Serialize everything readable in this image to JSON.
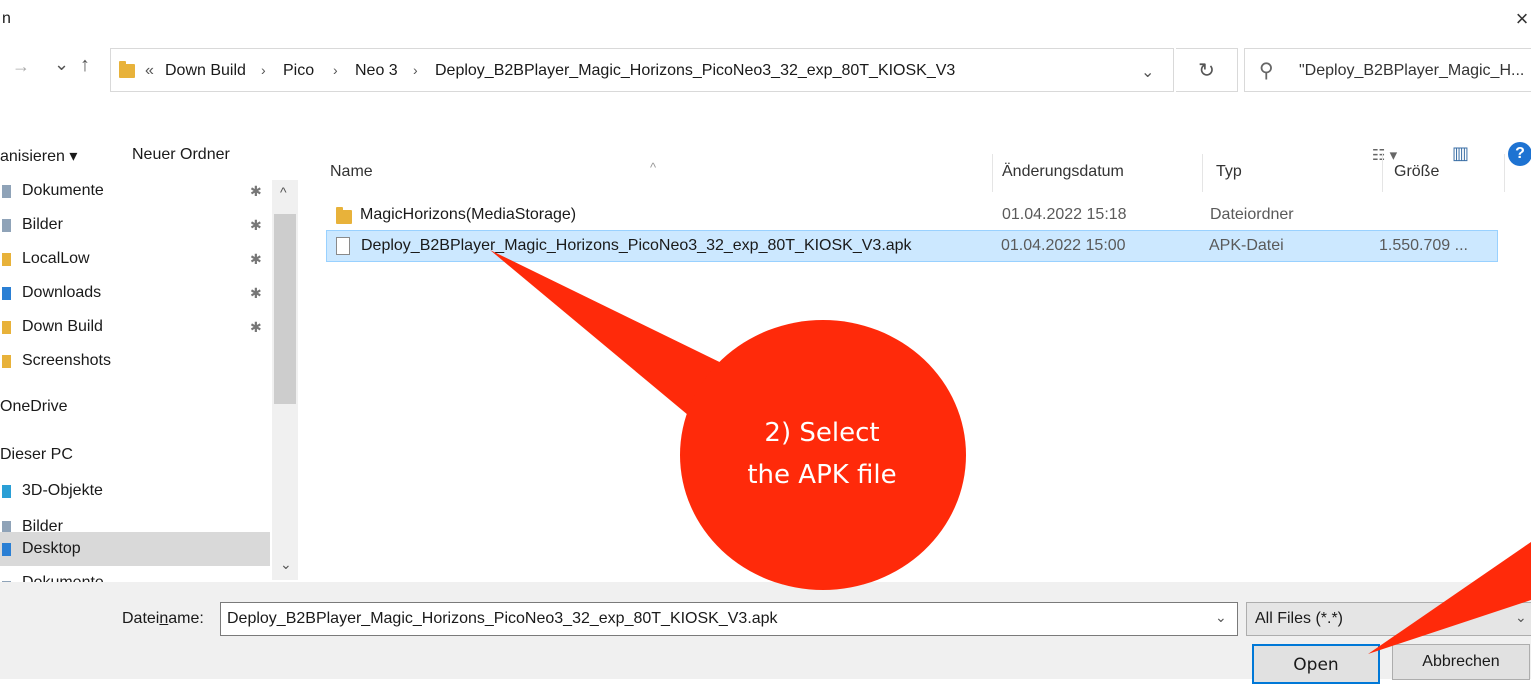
{
  "window": {
    "title": "n",
    "close_glyph": "×"
  },
  "nav": {
    "back_glyph": "→",
    "history_glyph": "⌄",
    "up_glyph": "↑",
    "breadcrumb_prefix": "«",
    "breadcrumb": [
      "Down Build",
      "Pico",
      "Neo 3",
      "Deploy_B2BPlayer_Magic_Horizons_PicoNeo3_32_exp_80T_KIOSK_V3"
    ],
    "separator": "›",
    "address_dropdown_glyph": "⌄",
    "refresh_glyph": "↻",
    "search_placeholder": "\"Deploy_B2BPlayer_Magic_H..."
  },
  "toolbar": {
    "organize_label": "anisieren ▾",
    "new_folder_label": "Neuer Ordner",
    "view_glyph": "☷ ▾",
    "pane_glyph": "▥",
    "help_glyph": "?"
  },
  "sidebar": {
    "items": [
      {
        "label": "Dokumente",
        "icon": "document-icon",
        "pinned": true
      },
      {
        "label": "Bilder",
        "icon": "pictures-icon",
        "pinned": true
      },
      {
        "label": "LocalLow",
        "icon": "folder-icon",
        "pinned": true
      },
      {
        "label": "Downloads",
        "icon": "download-icon",
        "pinned": true
      },
      {
        "label": "Down Build",
        "icon": "folder-icon",
        "pinned": true
      },
      {
        "label": "Screenshots",
        "icon": "folder-icon",
        "pinned": false
      },
      {
        "label": "OneDrive",
        "icon": "",
        "pinned": false
      },
      {
        "label": "Dieser PC",
        "icon": "",
        "pinned": false
      },
      {
        "label": "3D-Objekte",
        "icon": "cube-icon",
        "pinned": false
      },
      {
        "label": "Bilder",
        "icon": "pictures-icon",
        "pinned": false
      },
      {
        "label": "Desktop",
        "icon": "desktop-icon",
        "pinned": false,
        "selected": true
      },
      {
        "label": "Dokumente",
        "icon": "document-icon",
        "pinned": false
      }
    ],
    "pin_glyph": "✱",
    "scroll_up_glyph": "^",
    "scroll_down_glyph": "⌄"
  },
  "file_list": {
    "sort_glyph": "^",
    "columns": [
      "Name",
      "Änderungsdatum",
      "Typ",
      "Größe"
    ],
    "rows": [
      {
        "name": "MagicHorizons(MediaStorage)",
        "date": "01.04.2022 15:18",
        "type": "Dateiordner",
        "size": "",
        "icon": "folder-icon"
      },
      {
        "name": "Deploy_B2BPlayer_Magic_Horizons_PicoNeo3_32_exp_80T_KIOSK_V3.apk",
        "date": "01.04.2022 15:00",
        "type": "APK-Datei",
        "size": "1.550.709 ...",
        "icon": "file-icon",
        "selected": true
      }
    ]
  },
  "bottom": {
    "filename_label_pre": "Datei",
    "filename_label_u": "n",
    "filename_label_post": "ame:",
    "filename_value": "Deploy_B2BPlayer_Magic_Horizons_PicoNeo3_32_exp_80T_KIOSK_V3.apk",
    "filter_value": "All Files (*.*)",
    "dropdown_glyph": "⌄",
    "open_label": "Open",
    "cancel_label": "Abbrechen"
  },
  "annotation": {
    "line1": "2) Select",
    "line2": "the APK file",
    "color": "#ff2a0a"
  }
}
